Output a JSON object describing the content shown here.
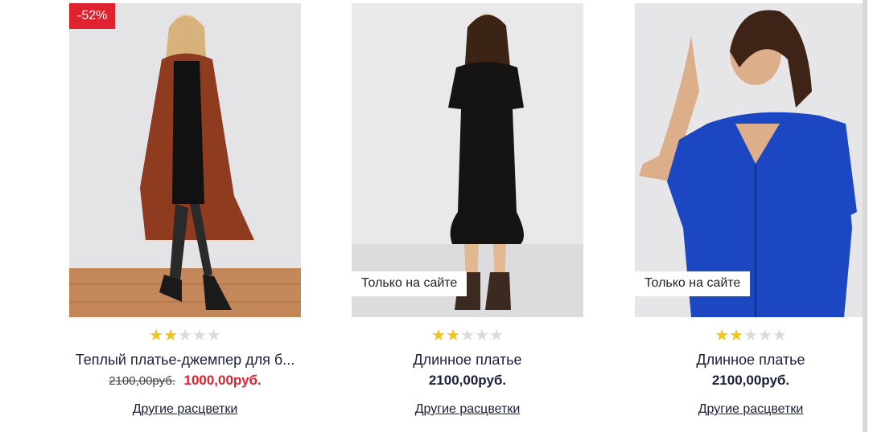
{
  "products": [
    {
      "sale_badge": "-52%",
      "online_badge": "",
      "rating": 2,
      "name": "Теплый платье-джемпер для б...",
      "old_price": "2100,00руб.",
      "price": "1000,00руб.",
      "colors_link": "Другие расцветки"
    },
    {
      "sale_badge": "",
      "online_badge": "Только на сайте",
      "rating": 2,
      "name": "Длинное платье",
      "old_price": "",
      "price": "2100,00руб.",
      "colors_link": "Другие расцветки"
    },
    {
      "sale_badge": "",
      "online_badge": "Только на сайте",
      "rating": 2,
      "name": "Длинное платье",
      "old_price": "",
      "price": "2100,00руб.",
      "colors_link": "Другие расцветки"
    }
  ],
  "colors": {
    "sale_red": "#e0212e",
    "star_on": "#f2c417",
    "star_off": "#d9d9de",
    "text_dark": "#1a1f3a"
  }
}
